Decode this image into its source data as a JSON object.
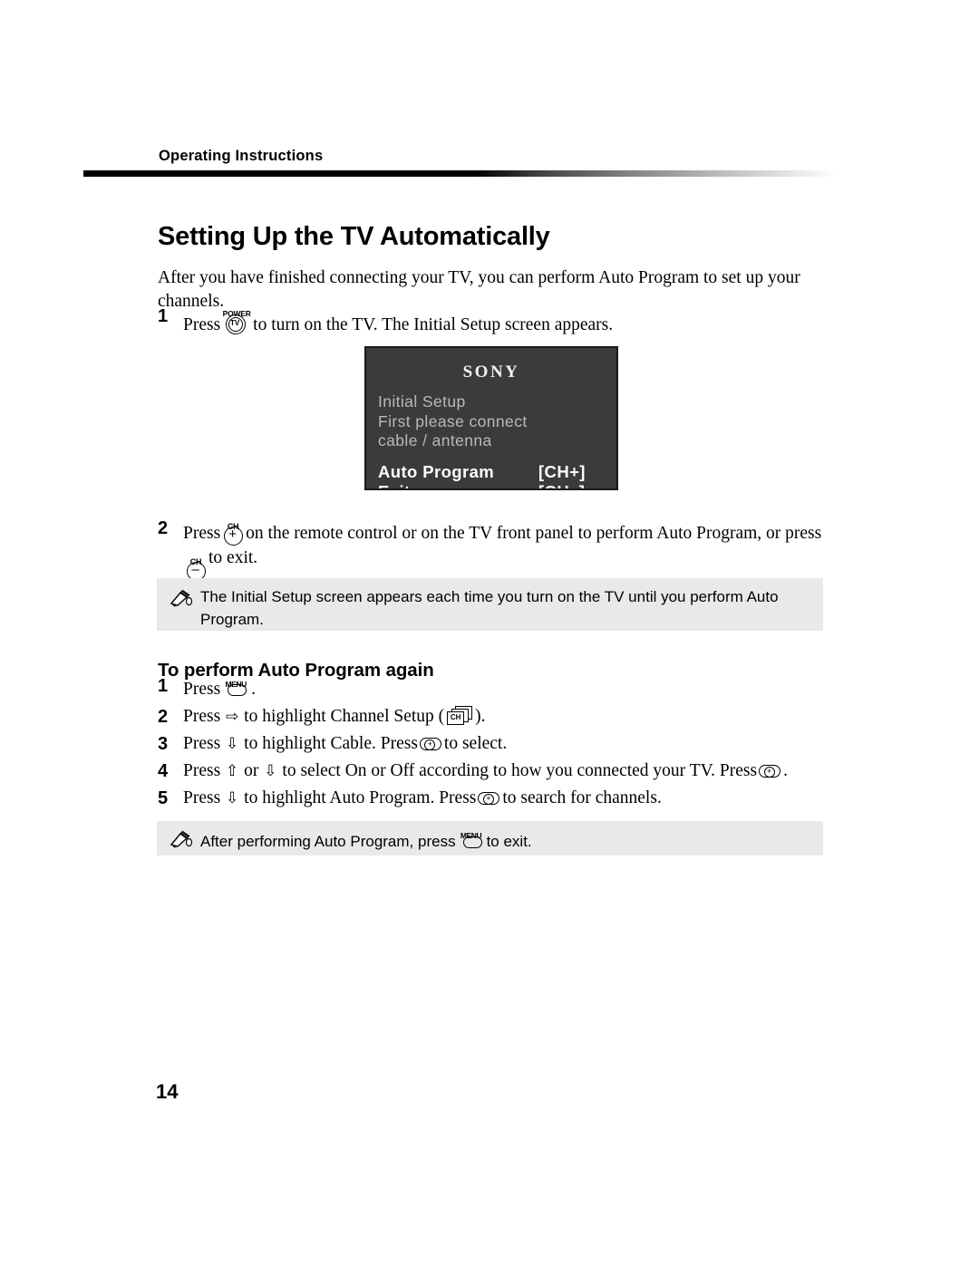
{
  "header": {
    "running_head": "Operating Instructions",
    "title": "Setting Up the TV Automatically"
  },
  "intro": "After you have finished connecting your TV, you can perform Auto Program to set up your channels.",
  "steps_primary": [
    {
      "num": "1",
      "text_before": "Press",
      "icon": "power-tv-button-icon",
      "icon_caption": "POWER",
      "icon_label": "TV",
      "text_after": "to turn on the TV. The Initial Setup screen appears."
    },
    {
      "num": "2",
      "text_before": "Press",
      "icon_a": "channel-up-button-icon",
      "icon_a_caption": "CH",
      "icon_a_sign": "+",
      "text_middle": "on the remote control or on the TV front panel to perform Auto Program, or press",
      "icon_b": "channel-down-button-icon",
      "icon_b_caption": "CH",
      "icon_b_sign": "–",
      "text_after": "to exit."
    }
  ],
  "tv_screen": {
    "logo": "SONY",
    "lines": [
      "Initial Setup",
      "First please connect",
      "cable / antenna"
    ],
    "options": [
      {
        "label": "Auto Program",
        "key": "[CH+]"
      },
      {
        "label": "Exit",
        "key": "[CH–]"
      }
    ],
    "bg_color": "#3b3b3b",
    "text_color": "#b9b9b9",
    "highlight_color": "#ffffff"
  },
  "note1": {
    "icon": "note-pencil-icon",
    "text": "The Initial Setup screen appears each time you turn on the TV until you perform Auto Program.",
    "bg_color": "#e9e9e9"
  },
  "subsection": {
    "heading": "To perform Auto Program again",
    "steps": [
      {
        "num": "1",
        "text_before": "Press",
        "icon": "menu-button-icon",
        "icon_caption": "MENU",
        "text_after": "."
      },
      {
        "num": "2",
        "text_before": "Press",
        "arrow": "⇨",
        "text_middle": "to highlight Channel Setup (",
        "icon": "channel-setup-icon",
        "icon_label": "CH",
        "text_after": ")."
      },
      {
        "num": "3",
        "text_before": "Press",
        "arrow": "⇩",
        "text_middle": "to highlight Cable. Press",
        "icon": "select-button-icon",
        "text_after": "to select."
      },
      {
        "num": "4",
        "text_before": "Press",
        "arrow": "⇧",
        "text_mid_a": "or",
        "arrow2": "⇩",
        "text_middle": "to select On or Off according to how you connected your TV. Press",
        "icon": "select-button-icon",
        "text_after": "."
      },
      {
        "num": "5",
        "text_before": "Press",
        "arrow": "⇩",
        "text_middle": "to highlight Auto Program. Press",
        "icon": "select-button-icon",
        "text_after": "to search for channels."
      }
    ]
  },
  "note2": {
    "icon": "note-pencil-icon",
    "text_before": "After performing Auto Program, press",
    "icon_menu": "menu-button-icon",
    "icon_menu_caption": "MENU",
    "text_after": "to exit.",
    "bg_color": "#e9e9e9"
  },
  "page_number": "14"
}
